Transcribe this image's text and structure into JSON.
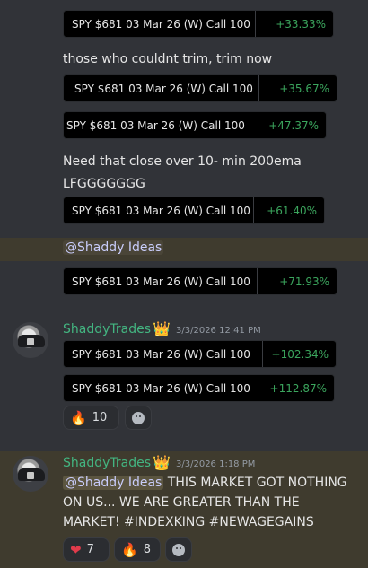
{
  "colors": {
    "background": "#313338",
    "mention_bg": "#3f3b2e",
    "gain": "#3ba55d",
    "username": "#43b581"
  },
  "cards": [
    {
      "label": "SPY $681 03 Mar 26 (W) Call 100",
      "pct": "+33.33%"
    },
    {
      "label": "SPY $681 03 Mar 26 (W) Call 100",
      "pct": "+35.67%"
    },
    {
      "label": "SPY $681 03 Mar 26 (W) Call 100",
      "pct": "+47.37%"
    },
    {
      "label": "SPY $681 03 Mar 26 (W) Call 100",
      "pct": "+61.40%"
    },
    {
      "label": "SPY $681 03 Mar 26 (W) Call 100",
      "pct": "+71.93%"
    },
    {
      "label": "SPY $681 03 Mar 26 (W) Call 100",
      "pct": "+102.34%"
    },
    {
      "label": "SPY $681 03 Mar 26 (W) Call 100",
      "pct": "+112.87%"
    }
  ],
  "messages": {
    "trim": "those who couldnt trim, trim now",
    "close_line1": "Need that close over 10- min 200ema",
    "close_line2": "LFGGGGGGG",
    "mention": "@Shaddy Ideas"
  },
  "post1": {
    "username": "ShaddyTrades",
    "crown_icon": "crown-icon",
    "timestamp": "3/3/2026 12:41 PM",
    "reactions": [
      {
        "emoji": "🔥",
        "icon": "fire-icon",
        "count": "10"
      }
    ]
  },
  "post2": {
    "username": "ShaddyTrades",
    "timestamp": "3/3/2026 1:18 PM",
    "mention": "@Shaddy Ideas",
    "text_line1": " THIS MARKET GOT NOTHING",
    "text_line2": "ON US... WE ARE GREATER THAN THE",
    "text_line3": "MARKET! #INDEXKING #NEWAGEGAINS",
    "reactions": [
      {
        "emoji": "❤️",
        "icon": "heart-icon",
        "count": "7"
      },
      {
        "emoji": "🔥",
        "icon": "fire-icon",
        "count": "8"
      }
    ]
  }
}
